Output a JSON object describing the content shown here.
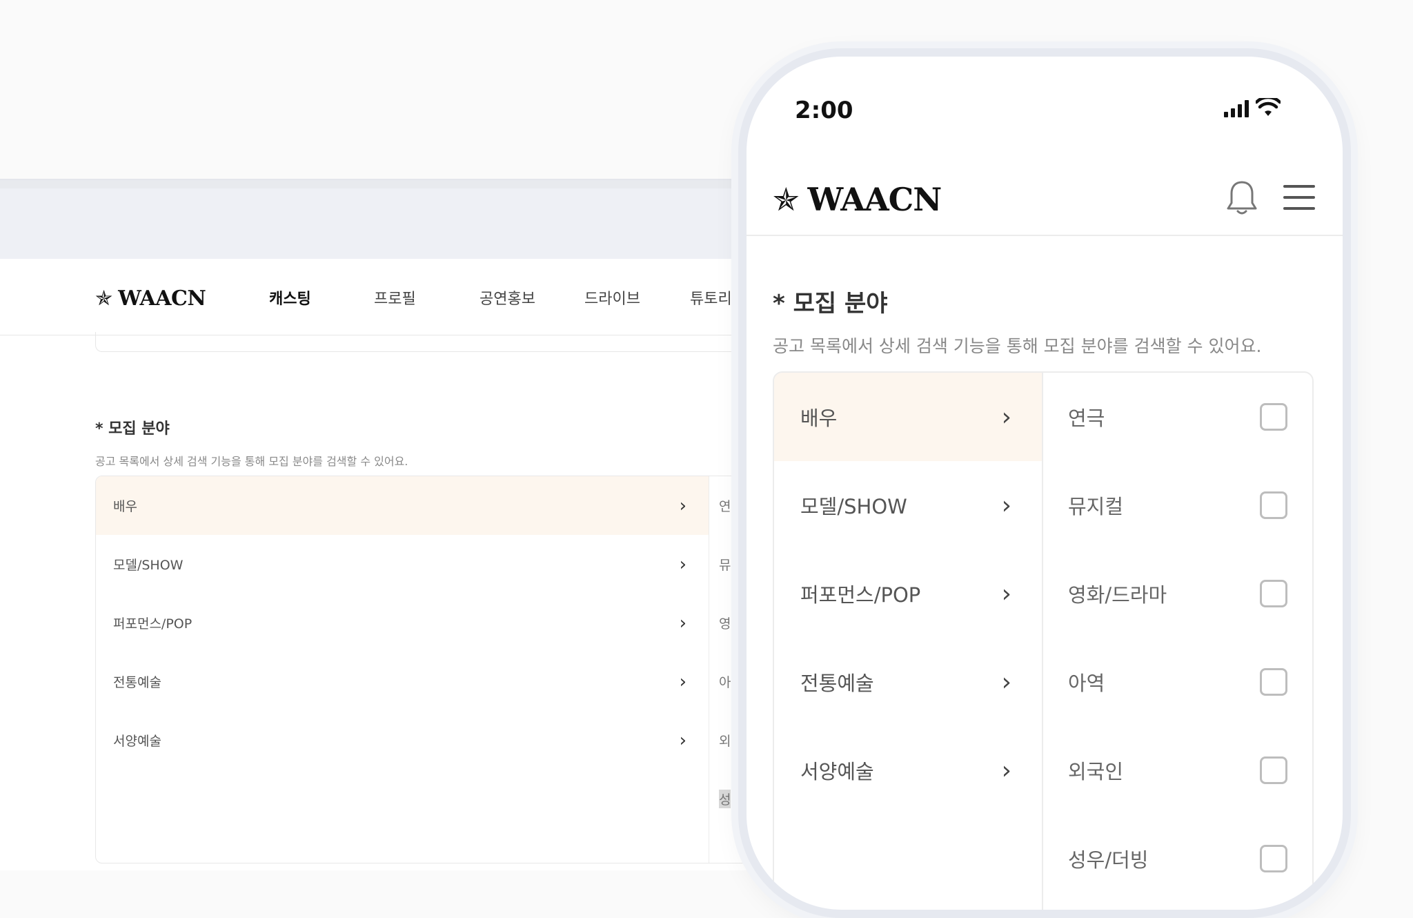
{
  "desktop": {
    "logo_text": "WAACN",
    "nav": [
      "캐스팅",
      "프로필",
      "공연홍보",
      "드라이브",
      "튜토리얼"
    ],
    "section_title": "* 모집 분야",
    "section_desc": "공고 목록에서 상세 검색 기능을 통해 모집 분야를 검색할 수 있어요.",
    "categories": [
      "배우",
      "모델/SHOW",
      "퍼포먼스/POP",
      "전통예술",
      "서양예술"
    ],
    "sub_items": [
      "연",
      "뮤",
      "영",
      "아",
      "외",
      "성"
    ]
  },
  "phone": {
    "time": "2:00",
    "logo_text": "WAACN",
    "section_title": "* 모집 분야",
    "section_desc": "공고 목록에서 상세 검색 기능을 통해 모집 분야를 검색할 수 있어요.",
    "categories": [
      "배우",
      "모델/SHOW",
      "퍼포먼스/POP",
      "전통예술",
      "서양예술"
    ],
    "sub_items": [
      "연극",
      "뮤지컬",
      "영화/드라마",
      "아역",
      "외국인",
      "성우/더빙"
    ]
  },
  "accent_color": "#fdf6ee"
}
